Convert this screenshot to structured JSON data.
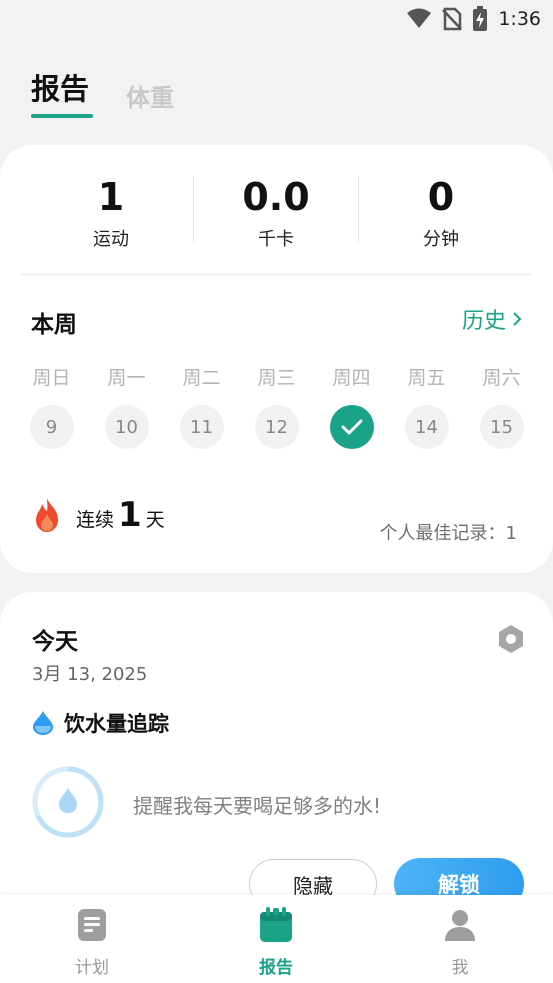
{
  "status_bar": {
    "time": "1:36",
    "icons": [
      "wifi-icon",
      "no-sim-icon",
      "battery-charging-icon"
    ]
  },
  "top_tabs": {
    "report": "报告",
    "weight": "体重"
  },
  "summary": [
    {
      "value": "1",
      "label": "运动"
    },
    {
      "value": "0.0",
      "label": "千卡"
    },
    {
      "value": "0",
      "label": "分钟"
    }
  ],
  "week": {
    "title": "本周",
    "history": "历史",
    "days": [
      {
        "name": "周日",
        "date": "9",
        "done": false
      },
      {
        "name": "周一",
        "date": "10",
        "done": false
      },
      {
        "name": "周二",
        "date": "11",
        "done": false
      },
      {
        "name": "周三",
        "date": "12",
        "done": false
      },
      {
        "name": "周四",
        "date": "13",
        "done": true
      },
      {
        "name": "周五",
        "date": "14",
        "done": false
      },
      {
        "name": "周六",
        "date": "15",
        "done": false
      }
    ]
  },
  "streak": {
    "prefix": "连续",
    "count": "1",
    "suffix": "天",
    "best": "个人最佳记录：1"
  },
  "today": {
    "title": "今天",
    "date": "3月 13, 2025",
    "water_title": "饮水量追踪",
    "water_text": "提醒我每天要喝足够多的水!",
    "hide_button": "隐藏",
    "unlock_button": "解锁"
  },
  "bottom_nav": [
    {
      "label": "计划",
      "icon": "plan-icon",
      "active": false
    },
    {
      "label": "报告",
      "icon": "calendar-icon",
      "active": true
    },
    {
      "label": "我",
      "icon": "person-icon",
      "active": false
    }
  ],
  "colors": {
    "accent": "#1aa389",
    "water_blue": "#2e9df0",
    "background": "#f2f2f5"
  }
}
